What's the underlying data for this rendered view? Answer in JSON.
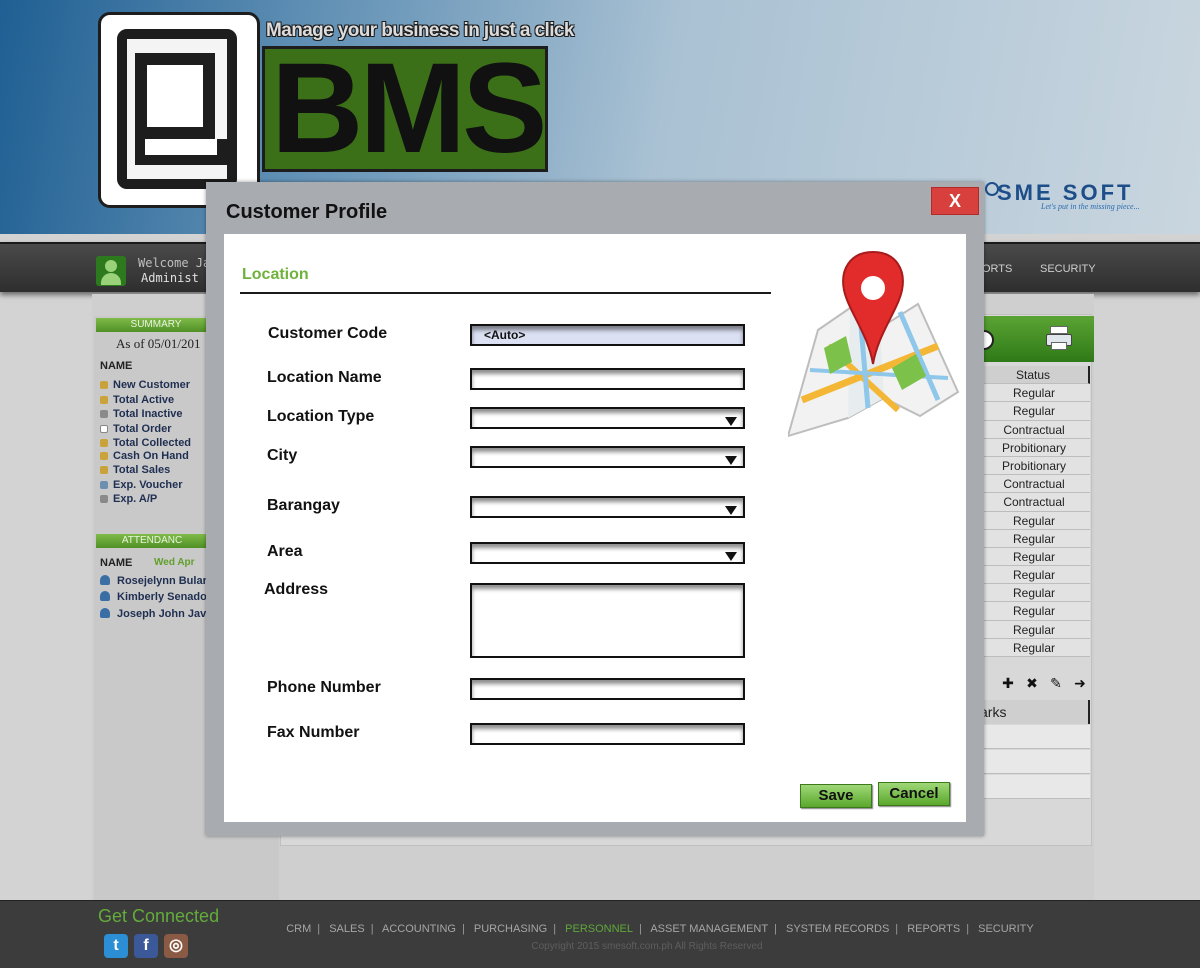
{
  "header": {
    "logo_letters": "BMS",
    "tagline": "Manage your business in just a click",
    "partner_name": "SME SOFT",
    "partner_slogan": "Let's put in the missing piece..."
  },
  "navbar": {
    "welcome": "Welcome Ja",
    "role": "Administ",
    "items_visible": [
      "ORTS",
      "SECURITY"
    ]
  },
  "sidebar": {
    "summary_title": "SUMMARY",
    "as_of": "As of 05/01/201",
    "name_header": "NAME",
    "items": [
      "New Customer",
      "Total Active",
      "Total Inactive",
      "Total Order",
      "Total Collected",
      "Cash On Hand",
      "Total Sales",
      "Exp. Voucher",
      "Exp. A/P"
    ],
    "attendance_title": "ATTENDANC",
    "attendance_date": "Wed Apr",
    "employees": [
      "Rosejelynn Bular",
      "Kimberly Senado",
      "Joseph John Javi"
    ]
  },
  "table": {
    "status_header": "Status",
    "statuses": [
      "Regular",
      "Regular",
      "Contractual",
      "Probitionary",
      "Probitionary",
      "Contractual",
      "Contractual",
      "Regular",
      "Regular",
      "Regular",
      "Regular",
      "Regular",
      "Regular",
      "Regular",
      "Regular"
    ],
    "remarks_header": "arks"
  },
  "modal": {
    "title": "Customer Profile",
    "close_label": "X",
    "section": "Location",
    "fields": {
      "customer_code": {
        "label": "Customer Code",
        "value": "<Auto>"
      },
      "location_name": {
        "label": "Location Name",
        "value": ""
      },
      "location_type": {
        "label": "Location Type",
        "value": ""
      },
      "city": {
        "label": "City",
        "value": ""
      },
      "barangay": {
        "label": "Barangay",
        "value": ""
      },
      "area": {
        "label": "Area",
        "value": ""
      },
      "address": {
        "label": "Address",
        "value": ""
      },
      "phone_number": {
        "label": "Phone Number",
        "value": ""
      },
      "fax_number": {
        "label": "Fax Number",
        "value": ""
      }
    },
    "save_label": "Save",
    "cancel_label": "Cancel"
  },
  "footer": {
    "get_connected": "Get Connected",
    "links": [
      "CRM",
      "SALES",
      "ACCOUNTING",
      "PURCHASING",
      "PERSONNEL",
      "ASSET MANAGEMENT",
      "SYSTEM RECORDS",
      "REPORTS",
      "SECURITY"
    ],
    "active_link": "PERSONNEL",
    "separator": "|",
    "copyright": "Copyright 2015   smesoft.com.ph   All Rights Reserved"
  },
  "icons": {
    "twitter": "twitter-icon",
    "facebook": "facebook-icon",
    "instagram": "instagram-icon",
    "map": "map-pin-icon",
    "print": "printer-icon",
    "add": "plus-icon",
    "delete": "x-icon",
    "edit": "pencil-icon",
    "next": "arrow-right-icon"
  },
  "colors": {
    "accent_green": "#6fb23c",
    "close_red": "#d8403d",
    "header_blue": "#1f5f93"
  }
}
